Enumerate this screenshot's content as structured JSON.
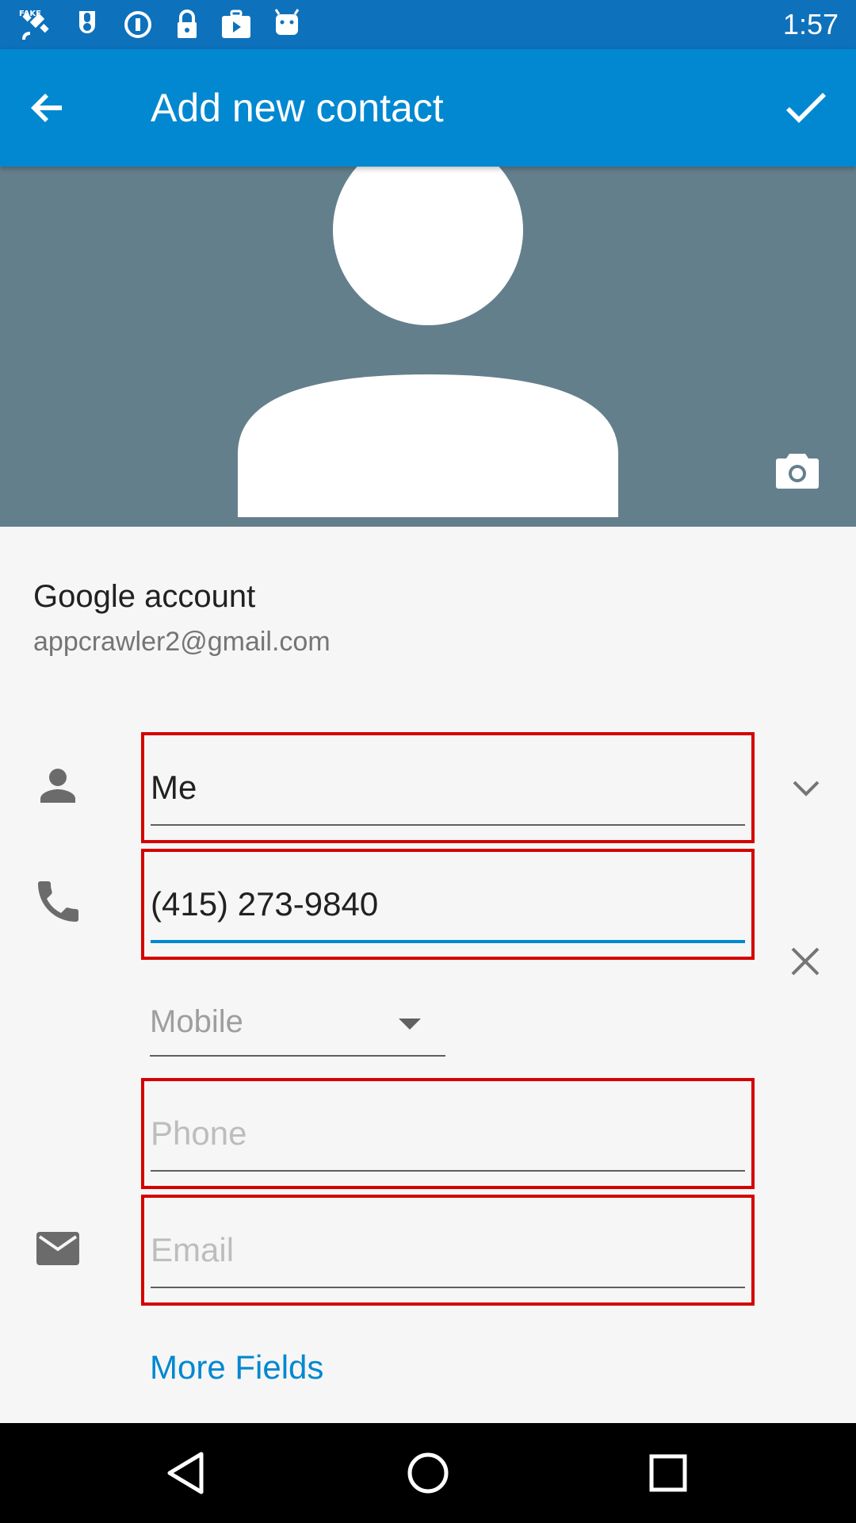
{
  "status_bar": {
    "time": "1:57",
    "icons": [
      "fake-gps-icon",
      "pocket-icon",
      "info-circle-icon",
      "lock-icon",
      "briefcase-play-icon",
      "android-icon"
    ]
  },
  "toolbar": {
    "title": "Add new contact",
    "back_icon": "arrow-back-icon",
    "save_icon": "check-icon",
    "background_color": "#0288d1"
  },
  "photo": {
    "background_color": "#647f8c",
    "camera_icon": "camera-icon"
  },
  "account": {
    "label": "Google account",
    "email": "appcrawler2@gmail.com"
  },
  "fields": {
    "name": {
      "value": "Me",
      "icon": "person-icon"
    },
    "phone": {
      "value": "(415) 273-9840",
      "icon": "phone-icon"
    },
    "phone_type": {
      "value": "Mobile"
    },
    "phone_extra": {
      "placeholder": "Phone"
    },
    "email": {
      "placeholder": "Email",
      "icon": "email-icon"
    }
  },
  "more_fields": {
    "label": "More Fields"
  },
  "navigation_bar": {
    "buttons": [
      "back-nav-icon",
      "home-nav-icon",
      "recents-nav-icon"
    ]
  },
  "colors": {
    "accent": "#0288d1",
    "highlight_border": "#d50000"
  }
}
